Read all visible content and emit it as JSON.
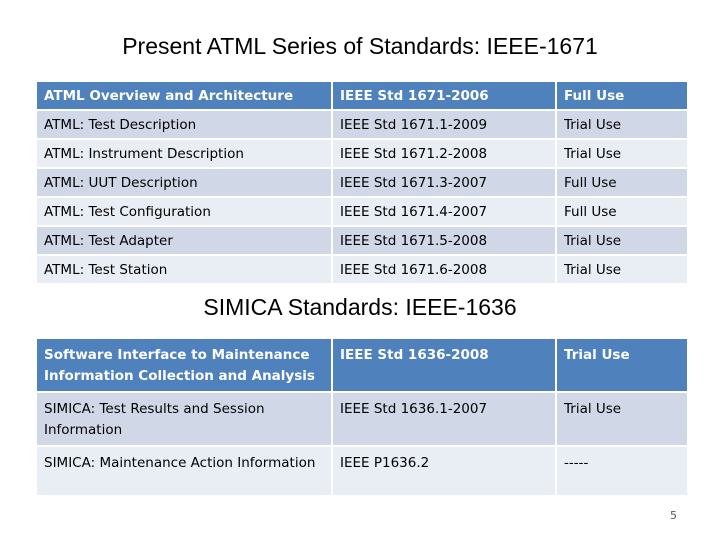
{
  "title": "Present ATML Series of Standards: IEEE-1671",
  "atml_table": {
    "rows": [
      {
        "name": "ATML Overview and Architecture",
        "standard": "IEEE Std 1671-2006",
        "status": "Full Use"
      },
      {
        "name": "ATML: Test Description",
        "standard": "IEEE Std 1671.1-2009",
        "status": "Trial Use"
      },
      {
        "name": "ATML: Instrument Description",
        "standard": "IEEE Std 1671.2-2008",
        "status": "Trial Use"
      },
      {
        "name": "ATML: UUT Description",
        "standard": "IEEE Std 1671.3-2007",
        "status": "Full Use"
      },
      {
        "name": "ATML: Test Configuration",
        "standard": "IEEE Std 1671.4-2007",
        "status": "Full Use"
      },
      {
        "name": "ATML: Test Adapter",
        "standard": "IEEE Std 1671.5-2008",
        "status": "Trial Use"
      },
      {
        "name": "ATML: Test Station",
        "standard": "IEEE Std 1671.6-2008",
        "status": "Trial Use"
      }
    ]
  },
  "subtitle": "SIMICA Standards: IEEE-1636",
  "simica_table": {
    "rows": [
      {
        "name": "Software Interface to Maintenance Information Collection and Analysis",
        "standard": "IEEE Std 1636-2008",
        "status": "Trial Use"
      },
      {
        "name": "SIMICA: Test Results and Session Information",
        "standard": "IEEE Std 1636.1-2007",
        "status": "Trial Use"
      },
      {
        "name": "SIMICA: Maintenance Action Information",
        "standard": "IEEE P1636.2",
        "status": "-----"
      }
    ]
  },
  "page_number": "5",
  "colors": {
    "header_blue": "#4f81bd",
    "row_band_dark": "#d0d8e8",
    "row_band_light": "#e9edf4"
  }
}
